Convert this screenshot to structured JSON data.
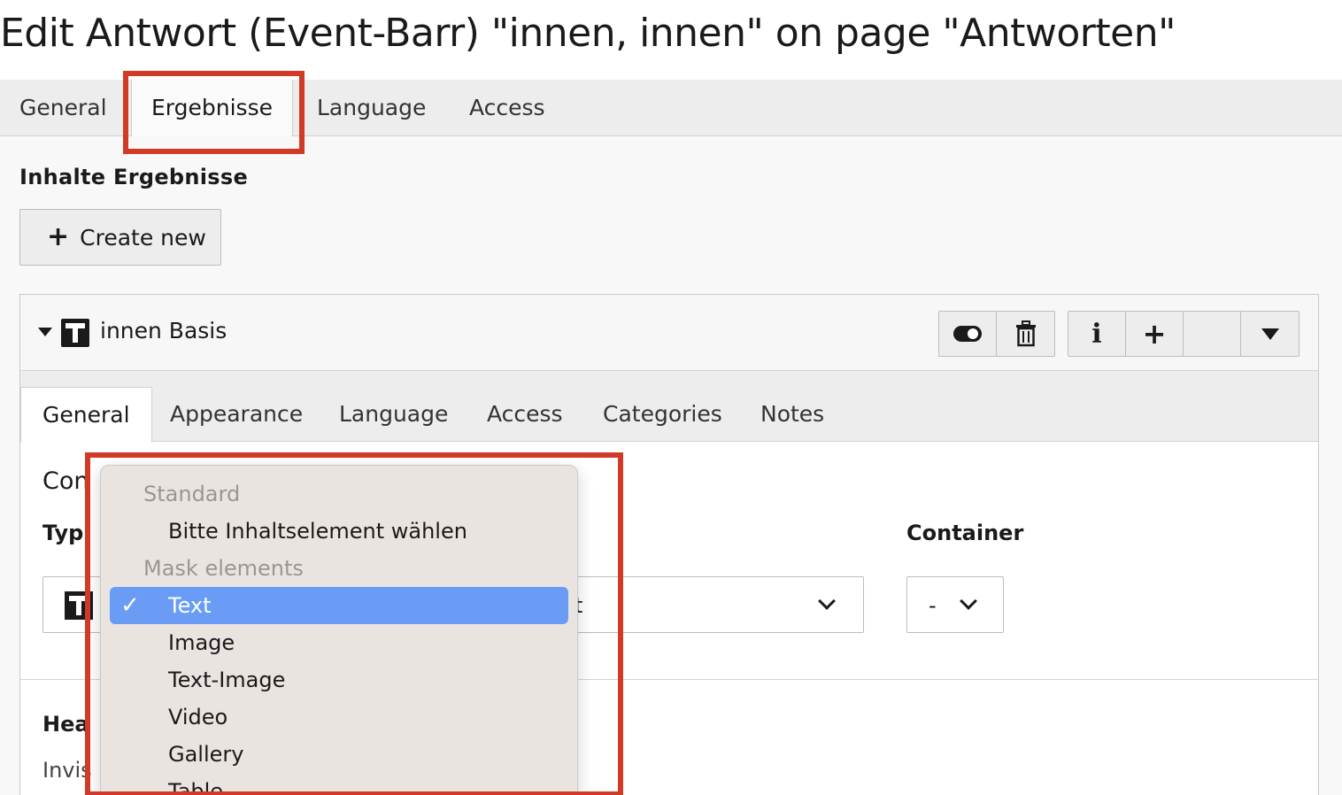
{
  "page": {
    "title": "Edit Antwort (Event-Barr) \"innen, innen\" on page \"Antworten\""
  },
  "outer_tabs": [
    {
      "label": "General",
      "active": false
    },
    {
      "label": "Ergebnisse",
      "active": true
    },
    {
      "label": "Language",
      "active": false
    },
    {
      "label": "Access",
      "active": false
    }
  ],
  "ergebnisse": {
    "section_title": "Inhalte Ergebnisse",
    "create_button": {
      "icon": "plus-icon",
      "label": "Create new"
    }
  },
  "content_card": {
    "title": "innen Basis",
    "icons": [
      "collapse-caret-icon",
      "text-element-icon",
      "toggle-visibility-icon",
      "trash-icon",
      "info-icon",
      "plus-icon",
      "dropdown-triangle-icon"
    ],
    "tabs": [
      {
        "label": "General",
        "active": true
      },
      {
        "label": "Appearance",
        "active": false
      },
      {
        "label": "Language",
        "active": false
      },
      {
        "label": "Access",
        "active": false
      },
      {
        "label": "Categories",
        "active": false
      },
      {
        "label": "Notes",
        "active": false
      }
    ],
    "visible_fragments": {
      "content_heading": "Con",
      "type_label": "Typ",
      "header_label": "Hea",
      "invisible_label": "Invis",
      "select_tail": "t"
    },
    "container": {
      "label": "Container",
      "value": "-"
    }
  },
  "type_dropdown": {
    "groups": [
      {
        "label": "Standard",
        "items": [
          {
            "label": "Bitte Inhaltselement wählen",
            "selected": false
          }
        ]
      },
      {
        "label": "Mask elements",
        "items": [
          {
            "label": "Text",
            "selected": true
          },
          {
            "label": "Image",
            "selected": false
          },
          {
            "label": "Text-Image",
            "selected": false
          },
          {
            "label": "Video",
            "selected": false
          },
          {
            "label": "Gallery",
            "selected": false
          },
          {
            "label": "Table",
            "selected": false
          }
        ]
      }
    ],
    "selected_mark": "✓"
  },
  "colors": {
    "highlight_border": "#d13a26",
    "selected_item_bg": "#6a9cf5",
    "tab_bar_bg": "#ededed"
  }
}
